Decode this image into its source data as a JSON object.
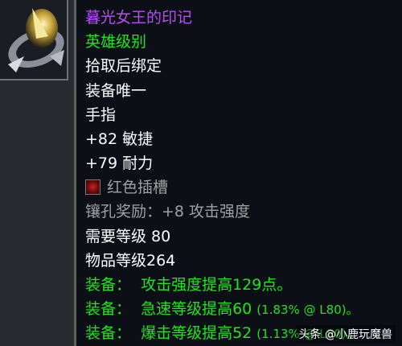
{
  "item": {
    "name": "暮光女王的印记",
    "quality": "英雄级别",
    "binding": "拾取后绑定",
    "unique": "装备唯一",
    "slot": "手指",
    "stats": [
      "+82 敏捷",
      "+79 耐力"
    ],
    "socket": {
      "icon": "red-socket-icon",
      "label": "红色插槽"
    },
    "socket_bonus": "镶孔奖励：+8 攻击强度",
    "required_level": "需要等级 80",
    "item_level": "物品等级264",
    "equip_effects": [
      {
        "prefix": "装备：",
        "text": "攻击强度提高129点。",
        "note": ""
      },
      {
        "prefix": "装备：",
        "text": "急速等级提高60",
        "note": "(1.83% @ L80)。"
      },
      {
        "prefix": "装备：",
        "text": "爆击等级提高52",
        "note": "(1.13% @ L80)。"
      }
    ]
  },
  "watermark": "头条 @小鹿玩魔兽",
  "colors": {
    "name": "#b550f0",
    "quality": "#1fe61f",
    "equip": "#1fe61f",
    "socket_bonus": "#a0a0a0",
    "tooltip_bg": "#0c0f16"
  },
  "icon": "ring-item-icon"
}
